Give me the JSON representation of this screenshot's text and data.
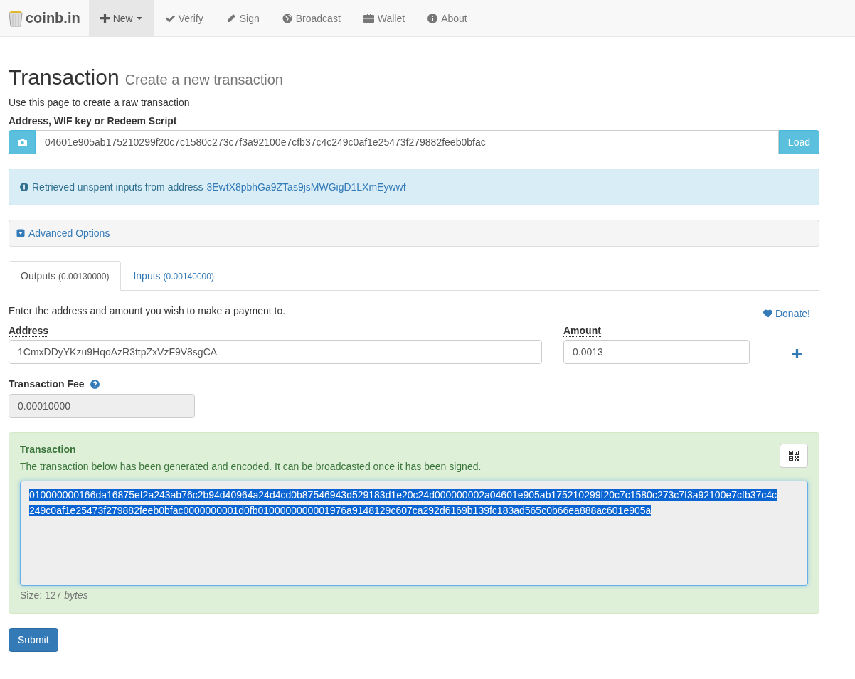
{
  "navbar": {
    "brand": "coinb.in",
    "items": [
      {
        "label": "New",
        "dropdown": true,
        "selected": true
      },
      {
        "label": "Verify",
        "dropdown": false,
        "selected": false
      },
      {
        "label": "Sign",
        "dropdown": false,
        "selected": false
      },
      {
        "label": "Broadcast",
        "dropdown": false,
        "selected": false
      },
      {
        "label": "Wallet",
        "dropdown": false,
        "selected": false
      },
      {
        "label": "About",
        "dropdown": false,
        "selected": false
      }
    ]
  },
  "header": {
    "title": "Transaction",
    "subtitle": "Create a new transaction",
    "description": "Use this page to create a raw transaction"
  },
  "source": {
    "label": "Address, WIF key or Redeem Script",
    "value": "04601e905ab175210299f20c7c1580c273c7f3a92100e7cfb37c4c249c0af1e25473f279882feeb0bfac",
    "button": "Load"
  },
  "alert": {
    "text": "Retrieved unspent inputs from address",
    "link": "3EwtX8pbhGa9ZTas9jsMWGigD1LXmEywwf"
  },
  "advanced": {
    "label": "Advanced Options",
    "expanded": false
  },
  "tabs": [
    {
      "label": "Outputs",
      "amount": "(0.00130000)",
      "selected": true
    },
    {
      "label": "Inputs",
      "amount": "(0.00140000)",
      "selected": false
    }
  ],
  "outputs": {
    "instruction": "Enter the address and amount you wish to make a payment to.",
    "donate": "Donate!",
    "address_label": "Address",
    "address": "1CmxDDyYKzu9HqoAzR3ttpZxVzF9V8sgCA",
    "amount_label": "Amount",
    "amount": "0.0013"
  },
  "fee": {
    "label": "Transaction Fee",
    "value": "0.00010000"
  },
  "transaction": {
    "title": "Transaction",
    "message": "The transaction below has been generated and encoded. It can be broadcasted once it has been signed.",
    "hex_lines": [
      "010000000166da16875ef2a243ab76c2b94d40964a24d4cd0b87546943d529183d1e20c24d000000002a04601e905ab175210299f20c7c1580c273c7f3a92100e7cfb37c4c",
      "249c0af1e25473f279882feeb0bfac0000000001d0fb0100000000001976a9148129c607ca292d6169b139fc183ad565c0b66ea888ac601e905a"
    ],
    "selected": true,
    "size": "Size: 127 *bytes*"
  },
  "submit": "Submit"
}
